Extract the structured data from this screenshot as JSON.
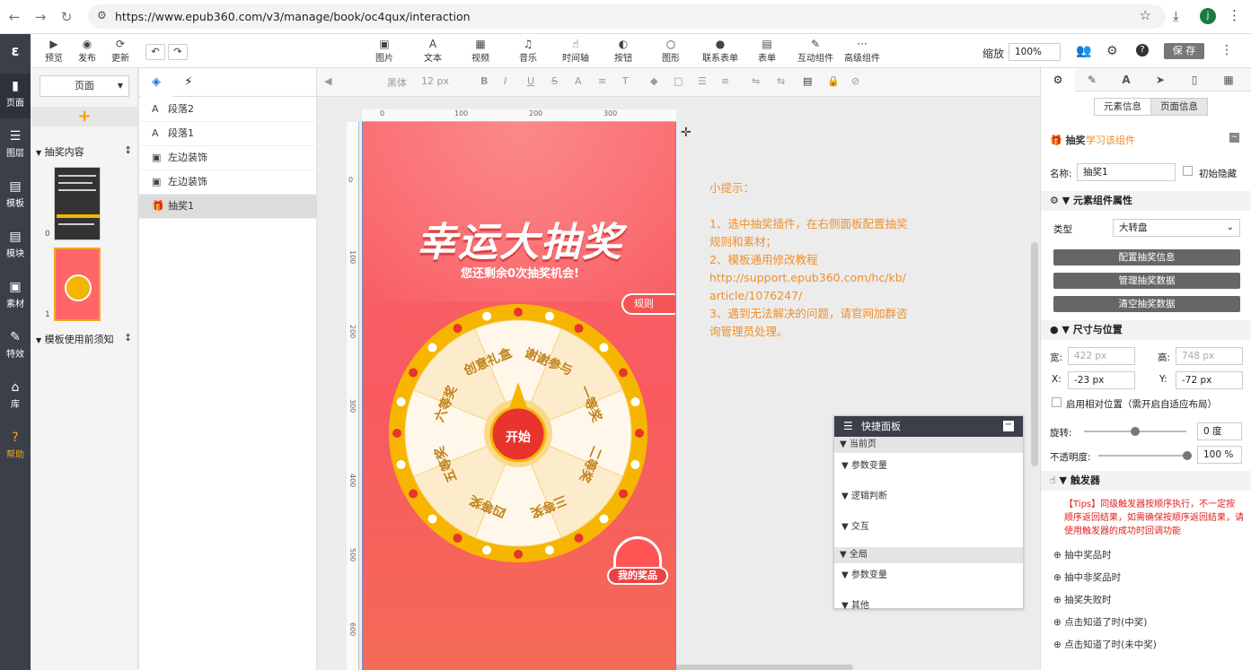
{
  "browser": {
    "url": "https://www.epub360.com/v3/manage/book/oc4qux/interaction",
    "avatar": "j"
  },
  "sidebar": {
    "logo": "ε",
    "items": [
      {
        "label": "页面"
      },
      {
        "label": "图层"
      },
      {
        "label": "模板"
      },
      {
        "label": "模块"
      },
      {
        "label": "素材"
      },
      {
        "label": "特效"
      },
      {
        "label": "库"
      },
      {
        "label": "帮助"
      }
    ]
  },
  "toolbar": {
    "left": [
      {
        "label": "预览"
      },
      {
        "label": "发布"
      },
      {
        "label": "更新"
      }
    ],
    "tools": [
      {
        "label": "图片"
      },
      {
        "label": "文本"
      },
      {
        "label": "视频"
      },
      {
        "label": "音乐"
      },
      {
        "label": "时间轴"
      },
      {
        "label": "按钮"
      },
      {
        "label": "图形"
      },
      {
        "label": "联系表单"
      },
      {
        "label": "表单"
      },
      {
        "label": "互动组件"
      },
      {
        "label": "高级组件"
      }
    ],
    "zoom_label": "缩放",
    "zoom_value": "100%",
    "save": "保 存"
  },
  "leftpanel": {
    "page_select": "页面",
    "group1": "抽奖内容",
    "group2": "模板使用前须知",
    "thumb_nums": [
      "0",
      "1"
    ]
  },
  "layers": {
    "items": [
      {
        "label": "段落2"
      },
      {
        "label": "段落1"
      },
      {
        "label": "左边装饰"
      },
      {
        "label": "左边装饰"
      },
      {
        "label": "抽奖1"
      }
    ]
  },
  "format": {
    "font": "黑体",
    "size": "12 px"
  },
  "ruler": {
    "top": [
      "0",
      "100",
      "200",
      "300"
    ],
    "left": [
      "0",
      "100",
      "200",
      "300",
      "400",
      "500",
      "600"
    ]
  },
  "phone": {
    "title": "幸运大抽奖",
    "subtitle": "您还剩余0次抽奖机会!",
    "rules": "规则",
    "start": "开始",
    "prize": "我的奖品",
    "segments": [
      "谢谢参与",
      "一等奖",
      "二等奖",
      "三等奖",
      "四等奖",
      "五等奖",
      "六等奖",
      "创意礼盒"
    ]
  },
  "hint": {
    "title": "小提示：",
    "lines": [
      "1、选中抽奖插件，在右侧面板配置抽奖规则和素材；",
      "2、模板通用修改教程",
      "http://support.epub360.com/hc/kb/article/1076247/",
      "3、遇到无法解决的问题，请官网加群咨询管理员处理。"
    ]
  },
  "quick": {
    "title": "快捷面板",
    "sec1": "当前页",
    "items1": [
      "参数变量",
      "逻辑判断",
      "交互"
    ],
    "sec2": "全局",
    "items2": [
      "参数变量",
      "其他"
    ]
  },
  "right": {
    "tab_elem": "元素信息",
    "tab_page": "页面信息",
    "comp": "抽奖",
    "learn": "学习该组件",
    "name_label": "名称:",
    "name_value": "抽奖1",
    "hide": "初始隐藏",
    "sec_props": "元素组件属性",
    "type_label": "类型",
    "type_value": "大转盘",
    "btns": [
      "配置抽奖信息",
      "管理抽奖数据",
      "清空抽奖数据"
    ],
    "sec_size": "尺寸与位置",
    "w_label": "宽:",
    "w_value": "422 px",
    "h_label": "高:",
    "h_value": "748 px",
    "x_label": "X:",
    "x_value": "-23 px",
    "y_label": "Y:",
    "y_value": "-72 px",
    "rel": "启用相对位置（需开启自适应布局）",
    "rot_label": "旋转:",
    "rot_value": "0 度",
    "op_label": "不透明度:",
    "op_value": "100 %",
    "sec_trig": "触发器",
    "tips": "【Tips】同级触发器按顺序执行，不一定按顺序返回结果，如需确保按顺序返回结果，请使用触发器的成功时回调功能",
    "triggers": [
      "抽中奖品时",
      "抽中非奖品时",
      "抽奖失败时",
      "点击知道了时(中奖)",
      "点击知道了时(未中奖)"
    ]
  }
}
